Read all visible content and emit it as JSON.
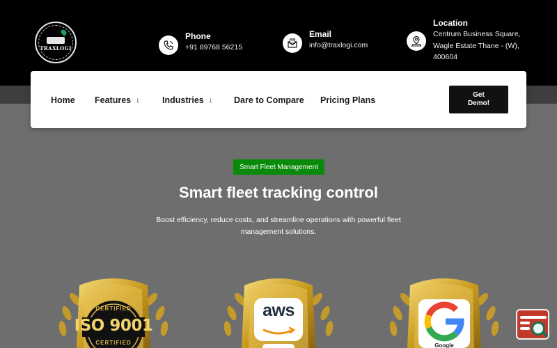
{
  "logo": {
    "text": "TRAXLOGI"
  },
  "contacts": [
    {
      "title": "Phone",
      "lines": [
        "+91 89768 56215"
      ],
      "icon": "phone-icon"
    },
    {
      "title": "Email",
      "lines": [
        "info@traxlogi.com"
      ],
      "icon": "mail-icon"
    },
    {
      "title": "Location",
      "lines": [
        "Centrum Business Square,",
        "Wagle Estate Thane - (W),",
        "400604"
      ],
      "icon": "location-icon"
    }
  ],
  "nav": {
    "items": [
      {
        "label": "Home",
        "dropdown": false
      },
      {
        "label": "Features",
        "dropdown": true
      },
      {
        "label": "Industries",
        "dropdown": true
      },
      {
        "label": "Dare to Compare",
        "dropdown": false
      },
      {
        "label": "Pricing Plans",
        "dropdown": false
      }
    ],
    "cta_line1": "Get",
    "cta_line2": "Demo!"
  },
  "hero": {
    "badge": "Smart Fleet Management",
    "title": "Smart fleet tracking control",
    "subtitle_line1": "Boost efficiency, reduce costs, and streamline operations with powerful fleet",
    "subtitle_line2": "management solutions."
  },
  "awards": [
    {
      "top": "CERTIFIED",
      "main": "ISO 9001",
      "bottom": "CERTIFIED"
    },
    {
      "main": "aws"
    },
    {
      "main": "G",
      "bottom": "Google"
    }
  ],
  "colors": {
    "accent_green": "#0a8a0a",
    "header_bg": "#000000",
    "hero_bg": "#6e6e6e",
    "gold": "#c99a1e"
  }
}
